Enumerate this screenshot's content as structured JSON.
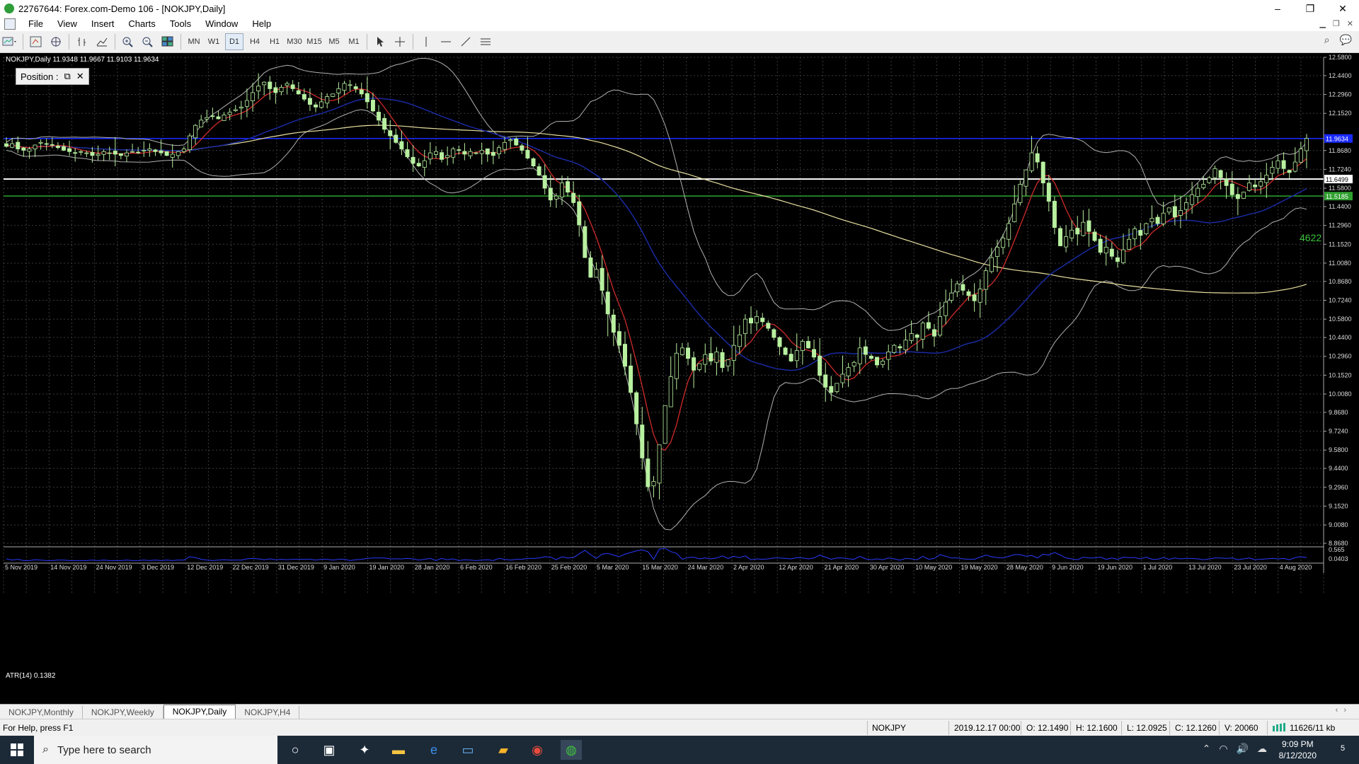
{
  "window": {
    "title": "22767644: Forex.com-Demo 106 - [NOKJPY,Daily]",
    "minimize": "–",
    "maximize": "❐",
    "close": "✕"
  },
  "menu": [
    "File",
    "View",
    "Insert",
    "Charts",
    "Tools",
    "Window",
    "Help"
  ],
  "toolbar": {
    "timeframes": [
      "MN",
      "W1",
      "D1",
      "H4",
      "H1",
      "M30",
      "M15",
      "M5",
      "M1"
    ],
    "active_timeframe": "D1",
    "icons": [
      "new-chart-icon",
      "profiles-icon",
      "market-watch-icon",
      "navigator-icon",
      "bar-chart-icon",
      "line-chart-icon",
      "zoom-in-icon",
      "zoom-out-icon",
      "tile-windows-icon",
      "cursor-icon",
      "crosshair-icon",
      "vertical-line-icon",
      "horizontal-line-icon",
      "trendline-icon",
      "channel-icon",
      "search-icon",
      "chat-icon"
    ]
  },
  "chart": {
    "info_label": "NOKJPY,Daily  11.9348 11.9667 11.9103 11.9634",
    "position_label": "Position :",
    "indicator_label": "ATR(14) 0.1382",
    "atr_ticks": [
      "0.565",
      "0.0403"
    ],
    "level_label": "4622",
    "colors": {
      "background": "#000000",
      "grid": "#3a3a3a",
      "candle": "#b8f0a0",
      "ma_fast": "#d02a2a",
      "ma_mid": "#1a2aa0",
      "ma_slow": "#e8e0a0",
      "bands": "#b0b0b0",
      "blue_level": "#1a2aff",
      "white_level": "#ffffff",
      "green_level": "#30a030"
    }
  },
  "chart_data": {
    "type": "candlestick",
    "symbol": "NOKJPY",
    "timeframe": "Daily",
    "ylim": [
      8.868,
      12.58
    ],
    "y_ticks": [
      "12.5800",
      "12.4400",
      "12.2960",
      "12.1520",
      "11.8680",
      "11.7240",
      "11.5800",
      "11.4400",
      "11.2960",
      "11.1520",
      "11.0080",
      "10.8680",
      "10.7240",
      "10.5800",
      "10.4400",
      "10.2960",
      "10.1520",
      "10.0080",
      "9.8680",
      "9.7240",
      "9.5800",
      "9.4400",
      "9.2960",
      "9.1520",
      "9.0080",
      "8.8680"
    ],
    "x_ticks": [
      "5 Nov 2019",
      "14 Nov 2019",
      "24 Nov 2019",
      "3 Dec 2019",
      "12 Dec 2019",
      "22 Dec 2019",
      "31 Dec 2019",
      "9 Jan 2020",
      "19 Jan 2020",
      "28 Jan 2020",
      "6 Feb 2020",
      "16 Feb 2020",
      "25 Feb 2020",
      "5 Mar 2020",
      "15 Mar 2020",
      "24 Mar 2020",
      "2 Apr 2020",
      "12 Apr 2020",
      "21 Apr 2020",
      "30 Apr 2020",
      "10 May 2020",
      "19 May 2020",
      "28 May 2020",
      "9 Jun 2020",
      "19 Jun 2020",
      "1 Jul 2020",
      "13 Jul 2020",
      "23 Jul 2020",
      "4 Aug 2020"
    ],
    "price_labels": [
      {
        "text": "11.9634",
        "value": 11.96,
        "bg": "#1a2aff",
        "color": "#ffffff"
      },
      {
        "text": "11.6499",
        "value": 11.65,
        "bg": "#ffffff",
        "color": "#000000"
      },
      {
        "text": "11.5185",
        "value": 11.52,
        "bg": "#30a030",
        "color": "#ffffff"
      }
    ],
    "horizontal_levels": [
      {
        "value": 11.96,
        "color": "#1a2aff"
      },
      {
        "value": 11.65,
        "color": "#ffffff"
      },
      {
        "value": 11.52,
        "color": "#30a030"
      }
    ],
    "close": [
      11.9,
      11.92,
      11.88,
      11.87,
      11.88,
      11.91,
      11.93,
      11.92,
      11.91,
      11.89,
      11.87,
      11.86,
      11.85,
      11.86,
      11.85,
      11.83,
      11.84,
      11.86,
      11.85,
      11.84,
      11.83,
      11.85,
      11.86,
      11.85,
      11.87,
      11.88,
      11.86,
      11.85,
      11.83,
      11.84,
      11.86,
      11.88,
      11.98,
      12.06,
      12.1,
      12.12,
      12.13,
      12.11,
      12.14,
      12.16,
      12.18,
      12.2,
      12.25,
      12.31,
      12.36,
      12.39,
      12.34,
      12.31,
      12.35,
      12.38,
      12.34,
      12.3,
      12.26,
      12.22,
      12.2,
      12.24,
      12.28,
      12.3,
      12.34,
      12.38,
      12.37,
      12.34,
      12.3,
      12.24,
      12.17,
      12.1,
      12.03,
      11.98,
      11.93,
      11.88,
      11.82,
      11.77,
      11.75,
      11.79,
      11.85,
      11.86,
      11.8,
      11.83,
      11.88,
      11.87,
      11.84,
      11.86,
      11.85,
      11.87,
      11.84,
      11.83,
      11.89,
      11.93,
      11.95,
      11.91,
      11.87,
      11.81,
      11.75,
      11.68,
      11.58,
      11.49,
      11.52,
      11.62,
      11.55,
      11.47,
      11.3,
      11.05,
      10.9,
      10.96,
      10.8,
      10.62,
      10.48,
      10.38,
      10.22,
      10.02,
      9.78,
      9.52,
      9.3,
      9.34,
      9.62,
      9.92,
      10.14,
      10.32,
      10.36,
      10.28,
      10.19,
      10.24,
      10.31,
      10.26,
      10.33,
      10.21,
      10.27,
      10.38,
      10.46,
      10.58,
      10.55,
      10.6,
      10.56,
      10.51,
      10.44,
      10.37,
      10.31,
      10.26,
      10.34,
      10.41,
      10.36,
      10.29,
      10.15,
      10.06,
      10.02,
      10.09,
      10.16,
      10.21,
      10.25,
      10.36,
      10.31,
      10.28,
      10.23,
      10.26,
      10.33,
      10.38,
      10.36,
      10.42,
      10.47,
      10.44,
      10.55,
      10.51,
      10.45,
      10.6,
      10.71,
      10.78,
      10.85,
      10.8,
      10.76,
      10.72,
      10.81,
      10.95,
      11.05,
      11.13,
      11.2,
      11.31,
      11.46,
      11.61,
      11.72,
      11.85,
      11.78,
      11.62,
      11.48,
      11.28,
      11.14,
      11.21,
      11.26,
      11.23,
      11.32,
      11.25,
      11.18,
      11.09,
      11.13,
      11.06,
      11.02,
      11.11,
      11.19,
      11.27,
      11.22,
      11.31,
      11.35,
      11.31,
      11.39,
      11.43,
      11.36,
      11.41,
      11.47,
      11.53,
      11.58,
      11.61,
      11.66,
      11.73,
      11.66,
      11.6,
      11.53,
      11.5,
      11.55,
      11.62,
      11.59,
      11.63,
      11.68,
      11.74,
      11.79,
      11.73,
      11.7,
      11.78,
      11.88,
      11.96
    ]
  },
  "tabs": [
    "NOKJPY,Monthly",
    "NOKJPY,Weekly",
    "NOKJPY,Daily",
    "NOKJPY,H4"
  ],
  "active_tab": "NOKJPY,Daily",
  "status": {
    "help": "For Help, press F1",
    "symbol": "NOKJPY",
    "datetime": "2019.12.17 00:00",
    "open": "O: 12.1490",
    "high": "H: 12.1600",
    "low": "L: 12.0925",
    "close": "C: 12.1260",
    "volume": "V: 20060",
    "traffic": "11626/11 kb"
  },
  "taskbar": {
    "search_placeholder": "Type here to search",
    "time": "9:09 PM",
    "date": "8/12/2020",
    "notification_count": "5"
  }
}
